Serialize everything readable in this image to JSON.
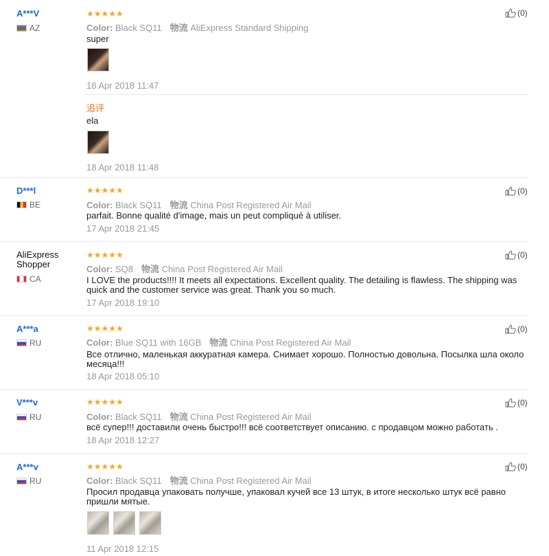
{
  "labels": {
    "color": "Color:",
    "shipping": "物流"
  },
  "reviews": [
    {
      "user": "A***V",
      "country": "AZ",
      "stars": "★★★★★",
      "color": "Black SQ11",
      "shipping": "AliExpress Standard Shipping",
      "text": "super",
      "date": "18 Apr 2018 11:47",
      "likes": "(0)",
      "followup": {
        "label": "追评",
        "text": "ela",
        "date": "18 Apr 2018 11:48"
      }
    },
    {
      "user": "D***l",
      "country": "BE",
      "stars": "★★★★★",
      "color": "Black SQ11",
      "shipping": "China Post Registered Air Mail",
      "text": "parfait. Bonne qualité d'image, mais un peut compliqué à utiliser.",
      "date": "17 Apr 2018 21:45",
      "likes": "(0)"
    },
    {
      "user_line1": "AliExpress",
      "user_line2": "Shopper",
      "country": "CA",
      "stars": "★★★★★",
      "color": "SQ8",
      "shipping": "China Post Registered Air Mail",
      "text": "I LOVE the products!!!! It meets all expectations. Excellent quality. The detailing is flawless. The shipping was quick and the customer service was great. Thank you so much.",
      "date": "17 Apr 2018 19:10",
      "likes": "(0)"
    },
    {
      "user": "A***a",
      "country": "RU",
      "stars": "★★★★★",
      "color": "Blue SQ11 with 16GB",
      "shipping": "China Post Registered Air Mail",
      "text": "Все отлично, маленькая аккуратная камера. Снимает хорошо. Полностью довольна. Посылка шла около месяца!!!",
      "date": "18 Apr 2018 05:10",
      "likes": "(0)"
    },
    {
      "user": "V***v",
      "country": "RU",
      "stars": "★★★★★",
      "color": "Black SQ11",
      "shipping": "China Post Registered Air Mail",
      "text": "всё супер!!! доставили очень быстро!!! всё соответствует описанию. с продавцом можно работать .",
      "date": "18 Apr 2018 12:27",
      "likes": "(0)"
    },
    {
      "user": "A***v",
      "country": "RU",
      "stars": "★★★★★",
      "color": "Black SQ11",
      "shipping": "China Post Registered Air Mail",
      "text": "Просил продавца упаковать получше, упаковал кучей все 13 штук, в итоге несколько штук всё равно пришли мятые.",
      "date": "11 Apr 2018 12:15",
      "likes": "(0)"
    }
  ]
}
